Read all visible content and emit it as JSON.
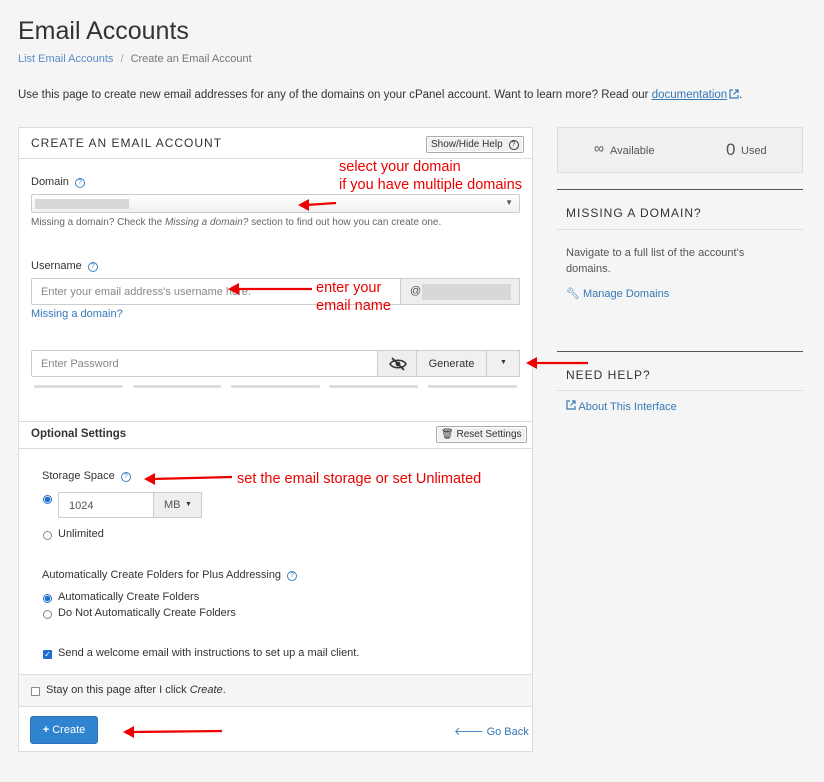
{
  "header": {
    "title": "Email Accounts",
    "breadcrumb_parent": "List Email Accounts",
    "breadcrumb_sep": "/",
    "breadcrumb_current": "Create an Email Account"
  },
  "intro": {
    "text": "Use this page to create new email addresses for any of the domains on your cPanel account. Want to learn more? Read our",
    "link": "documentation",
    "suffix": "."
  },
  "form": {
    "section_title": "CREATE AN EMAIL ACCOUNT",
    "show_hide_help": "Show/Hide Help",
    "domain_label": "Domain",
    "domain_hint_pre": "Missing a domain? Check the",
    "domain_hint_em": "Missing a domain?",
    "domain_hint_post": "section to find out how you can create one.",
    "username_label": "Username",
    "username_placeholder": "Enter your email address's username here.",
    "at_sign": "@",
    "missing_domain_link": "Missing a domain?",
    "password_placeholder": "Enter Password",
    "generate_label": "Generate",
    "optional_title": "Optional Settings",
    "reset_settings": "Reset Settings",
    "storage_label": "Storage Space",
    "storage_value": "1024",
    "storage_unit": "MB",
    "unlimited_label": "Unlimited",
    "plus_addressing_label": "Automatically Create Folders for Plus Addressing",
    "auto_create_label": "Automatically Create Folders",
    "no_auto_create_label": "Do Not Automatically Create Folders",
    "welcome_email_label": "Send a welcome email with instructions to set up a mail client.",
    "stay_on_page_pre": "Stay on this page after I click",
    "stay_on_page_em": "Create",
    "stay_on_page_post": ".",
    "create_button": "Create",
    "go_back": "Go Back"
  },
  "sidebar": {
    "available_symbol": "∞",
    "available_label": "Available",
    "used_count": "0",
    "used_label": "Used",
    "missing_domain_title": "MISSING A DOMAIN?",
    "missing_domain_text": "Navigate to a full list of the account's domains.",
    "manage_domains": "Manage Domains",
    "need_help_title": "NEED HELP?",
    "about_interface": "About This Interface"
  },
  "annotations": {
    "domain_note_1": "select your domain",
    "domain_note_2": "if you have multiple domains",
    "username_note_1": "enter your",
    "username_note_2": "email name",
    "storage_note": "set the email storage or set Unlimated"
  },
  "colors": {
    "accent": "#3479b7",
    "create_button_bg": "#2f84d0",
    "annotation": "#e00000"
  },
  "icons": {
    "help": "question-circle",
    "external_link": "external-link",
    "eye_slash": "eye-slash",
    "trash": "trash",
    "wrench": "wrench",
    "plus": "plus",
    "back_arrow": "arrow-left"
  }
}
